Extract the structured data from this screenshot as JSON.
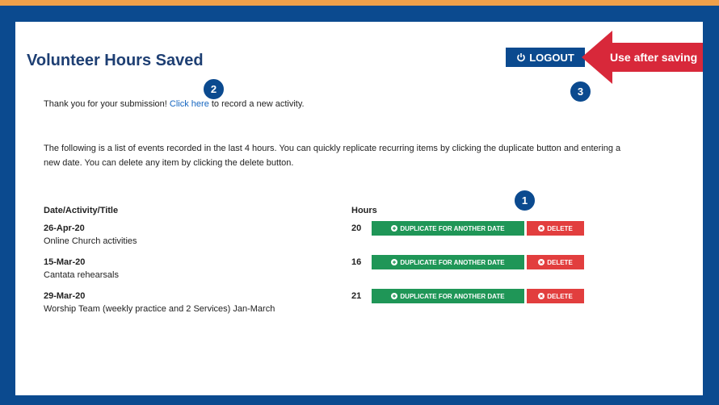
{
  "page": {
    "title": "Volunteer Hours Saved",
    "logout_label": "LOGOUT"
  },
  "callout": {
    "text": "Use after saving",
    "color": "#d8283a"
  },
  "badges": {
    "one": "1",
    "two": "2",
    "three": "3"
  },
  "intro": {
    "prefix": "Thank you for your submission! ",
    "link": "Click here",
    "suffix": " to record a new activity."
  },
  "description": "The following is a list of events recorded in the last 4 hours. You can quickly replicate recurring items by clicking the duplicate button and entering a new date. You can delete any item by clicking the delete button.",
  "table": {
    "col_activity": "Date/Activity/Title",
    "col_hours": "Hours",
    "duplicate_label": "DUPLICATE FOR ANOTHER DATE",
    "delete_label": "DELETE",
    "rows": [
      {
        "date": "26-Apr-20",
        "activity": "Online Church activities",
        "hours": "20"
      },
      {
        "date": "15-Mar-20",
        "activity": "Cantata rehearsals",
        "hours": "16"
      },
      {
        "date": "29-Mar-20",
        "activity": "Worship Team (weekly practice and 2 Services) Jan-March",
        "hours": "21"
      }
    ]
  },
  "colors": {
    "frame": "#0b4a8f",
    "border": "#f0a04a",
    "duplicate": "#1f9657",
    "delete": "#e23e3e",
    "title": "#1e3f73"
  },
  "icons": {
    "logout": "power-icon",
    "duplicate": "plus-circle-icon",
    "delete": "x-circle-icon"
  }
}
